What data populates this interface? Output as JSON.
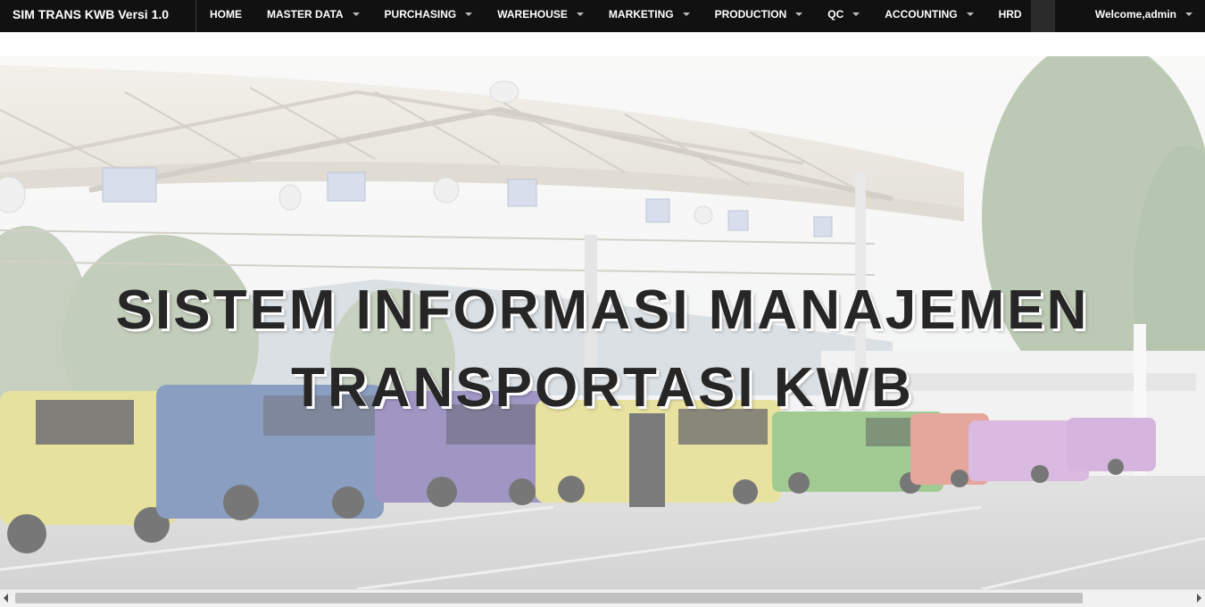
{
  "app": {
    "brand": "SIM TRANS KWB Versi 1.0",
    "welcome": "Welcome,admin"
  },
  "nav": {
    "items": [
      {
        "label": "HOME"
      },
      {
        "label": "MASTER DATA"
      },
      {
        "label": "PURCHASING"
      },
      {
        "label": "WAREHOUSE"
      },
      {
        "label": "MARKETING"
      },
      {
        "label": "PRODUCTION"
      },
      {
        "label": "QC"
      },
      {
        "label": "ACCOUNTING"
      },
      {
        "label": "HRD"
      }
    ]
  },
  "hero": {
    "line1": "SISTEM INFORMASI MANAJEMEN",
    "line2": "TRANSPORTASI KWB"
  },
  "colors": {
    "navbar": "#111111",
    "title_text": "#262626"
  },
  "icons": [
    "caret-down-icon",
    "scroll-left-arrow-icon",
    "scroll-right-arrow-icon"
  ]
}
